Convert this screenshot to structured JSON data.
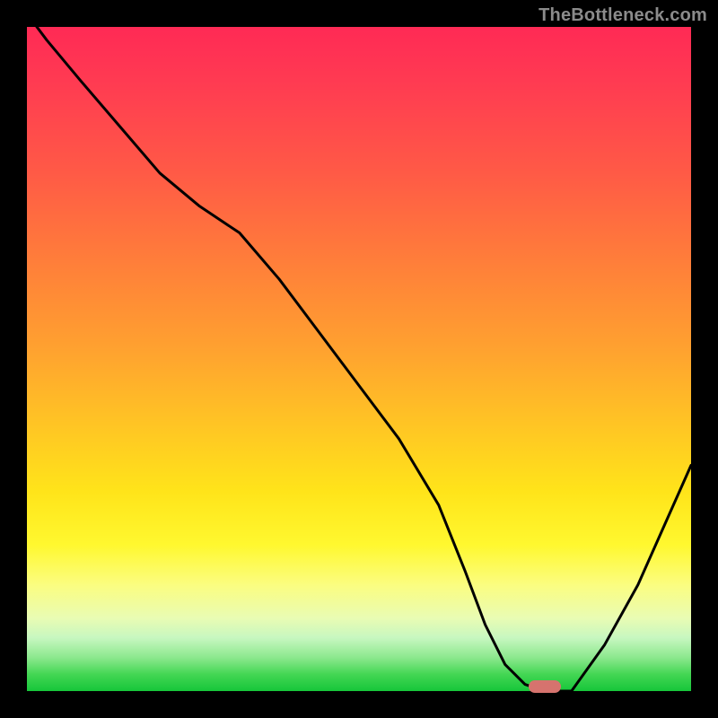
{
  "watermark": "TheBottleneck.com",
  "colors": {
    "frame_bg": "#000000",
    "curve_stroke": "#000000",
    "marker_fill": "#d6736e",
    "watermark_text": "#8b8b8b"
  },
  "chart_data": {
    "type": "line",
    "title": "",
    "xlabel": "",
    "ylabel": "",
    "xlim": [
      0,
      100
    ],
    "ylim": [
      0,
      100
    ],
    "grid": false,
    "legend": false,
    "series": [
      {
        "name": "bottleneck-curve",
        "x": [
          0,
          3,
          8,
          14,
          20,
          26,
          32,
          38,
          44,
          50,
          56,
          62,
          66,
          69,
          72,
          75,
          78,
          82,
          87,
          92,
          96,
          100
        ],
        "y": [
          102,
          98,
          92,
          85,
          78,
          73,
          69,
          62,
          54,
          46,
          38,
          28,
          18,
          10,
          4,
          1,
          0,
          0,
          7,
          16,
          25,
          34
        ]
      }
    ],
    "annotations": [
      {
        "name": "optimum-marker",
        "x": 78,
        "y": 0,
        "shape": "pill"
      }
    ],
    "background_gradient_description": "vertical heat gradient: red/pink at top through orange, yellow, pale green, to saturated green at the bottom edge"
  }
}
